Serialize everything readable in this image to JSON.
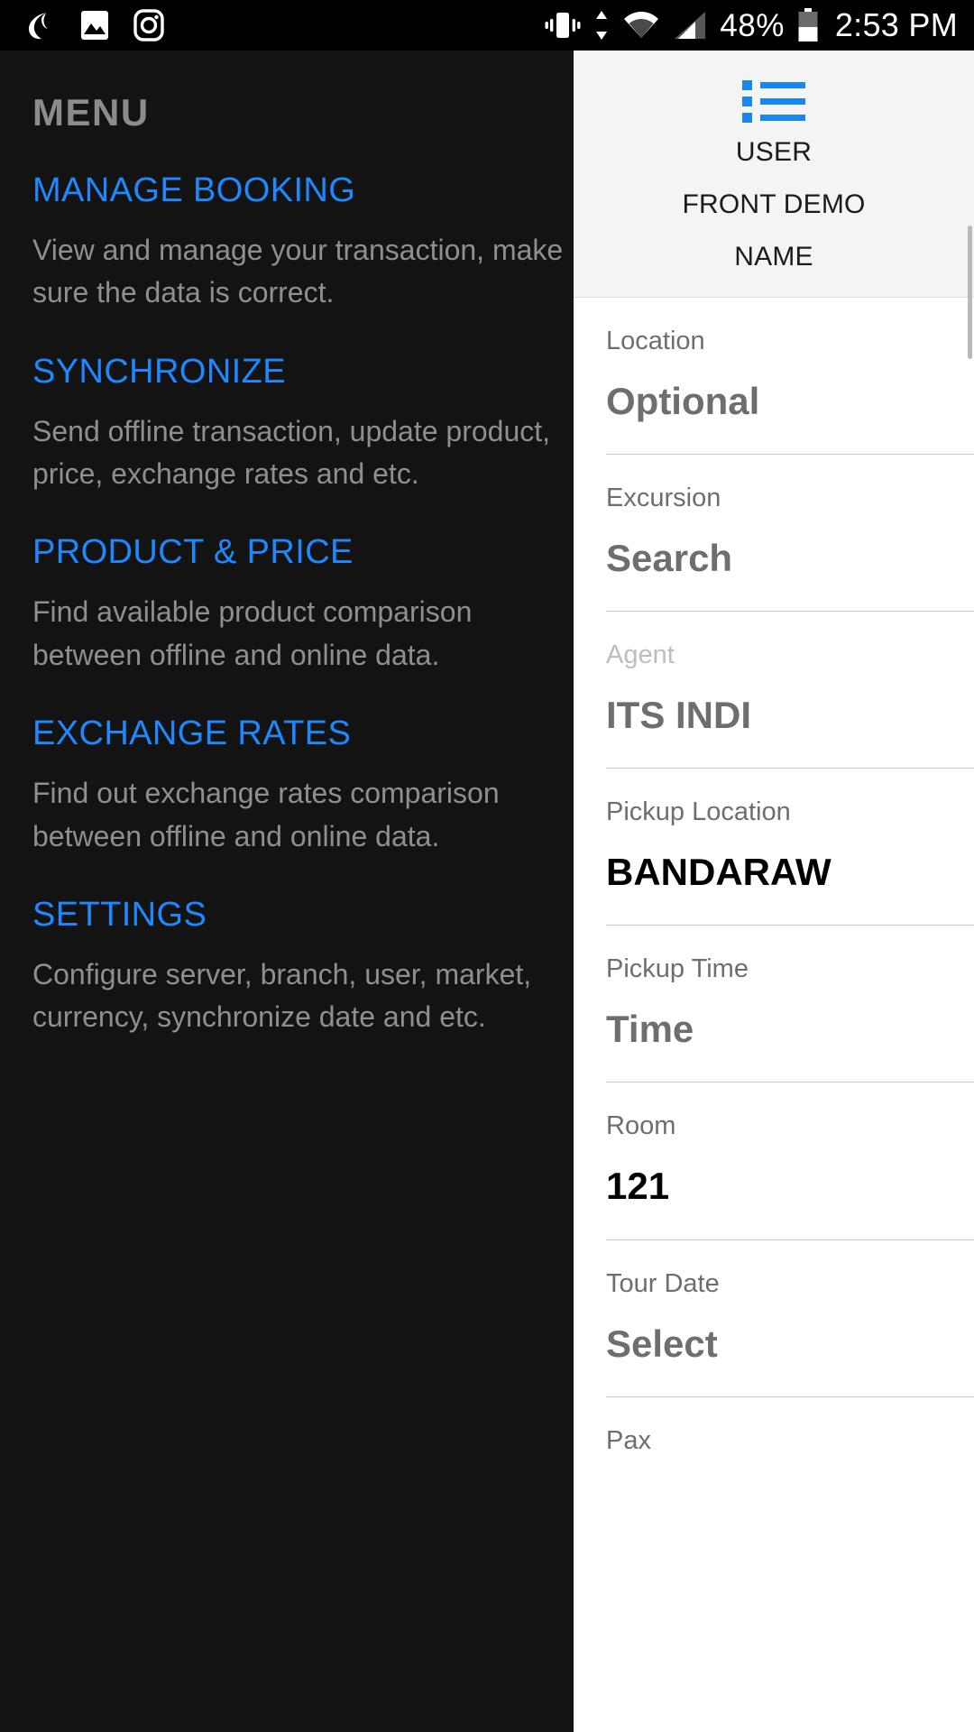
{
  "status_bar": {
    "notification_icons": [
      "moon-crescent-icon",
      "gallery-image-icon",
      "instagram-camera-icon"
    ],
    "system_icons": [
      "vibrate-icon",
      "data-transfer-icon",
      "wifi-icon",
      "cellular-signal-icon",
      "battery-icon"
    ],
    "battery_percent": "48%",
    "clock": "2:53 PM"
  },
  "drawer": {
    "title": "MENU",
    "items": [
      {
        "label": "MANAGE BOOKING",
        "description": "View and manage your transaction, make sure the data is correct."
      },
      {
        "label": "SYNCHRONIZE",
        "description": "Send offline transaction, update product, price, exchange rates and etc."
      },
      {
        "label": "PRODUCT & PRICE",
        "description": "Find available product comparison between offline and online data."
      },
      {
        "label": "EXCHANGE RATES",
        "description": "Find out exchange rates comparison between offline and online data."
      },
      {
        "label": "SETTINGS",
        "description": "Configure server, branch, user, market, currency, synchronize date and etc."
      }
    ]
  },
  "content_panel": {
    "menu_icon": "list-icon",
    "header_lines": [
      "USER",
      "FRONT DEMO",
      "NAME"
    ],
    "form_fields": [
      {
        "label": "Location",
        "value": "Optional",
        "filled": false,
        "label_muted": false
      },
      {
        "label": "Excursion",
        "value": "Search",
        "filled": false,
        "label_muted": false
      },
      {
        "label": "Agent",
        "value": "ITS INDI",
        "filled": false,
        "label_muted": true
      },
      {
        "label": "Pickup Location",
        "value": "BANDARAW",
        "filled": true,
        "label_muted": false
      },
      {
        "label": "Pickup Time",
        "value": "Time",
        "filled": false,
        "label_muted": false
      },
      {
        "label": "Room",
        "value": "121",
        "filled": true,
        "label_muted": false
      },
      {
        "label": "Tour Date",
        "value": "Select",
        "filled": false,
        "label_muted": false
      },
      {
        "label": "Pax",
        "value": "",
        "filled": false,
        "label_muted": false
      }
    ]
  },
  "colors": {
    "accent_blue": "#1e88ff",
    "drawer_background": "#131313",
    "status_bar_background": "#000000",
    "panel_header_background": "#f4f4f4",
    "panel_background": "#ffffff"
  }
}
